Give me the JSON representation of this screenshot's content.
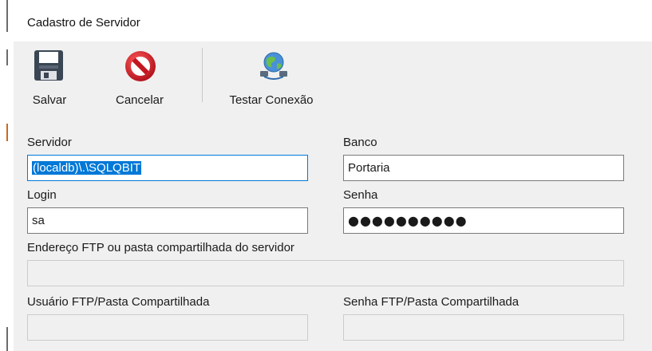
{
  "window": {
    "title": "Cadastro de Servidor"
  },
  "toolbar": {
    "save": {
      "label": "Salvar",
      "icon": "floppy-disk-icon"
    },
    "cancel": {
      "label": "Cancelar",
      "icon": "prohibited-icon"
    },
    "test": {
      "label": "Testar Conexão",
      "icon": "network-globe-icon"
    }
  },
  "form": {
    "servidor": {
      "label": "Servidor",
      "value": "(localdb)\\.\\SQLQBIT",
      "selected": true
    },
    "banco": {
      "label": "Banco",
      "value": "Portaria"
    },
    "login": {
      "label": "Login",
      "value": "sa"
    },
    "senha": {
      "label": "Senha",
      "value": "●●●●●●●●●●"
    },
    "ftp_endereco": {
      "label": "Endereço FTP ou pasta compartilhada do servidor",
      "value": ""
    },
    "ftp_usuario": {
      "label": "Usuário FTP/Pasta Compartilhada",
      "value": ""
    },
    "ftp_senha": {
      "label": "Senha FTP/Pasta Compartilhada",
      "value": ""
    }
  },
  "colors": {
    "selection": "#0078d7",
    "focus_border": "#0078d7",
    "cancel_red": "#d0202a"
  }
}
